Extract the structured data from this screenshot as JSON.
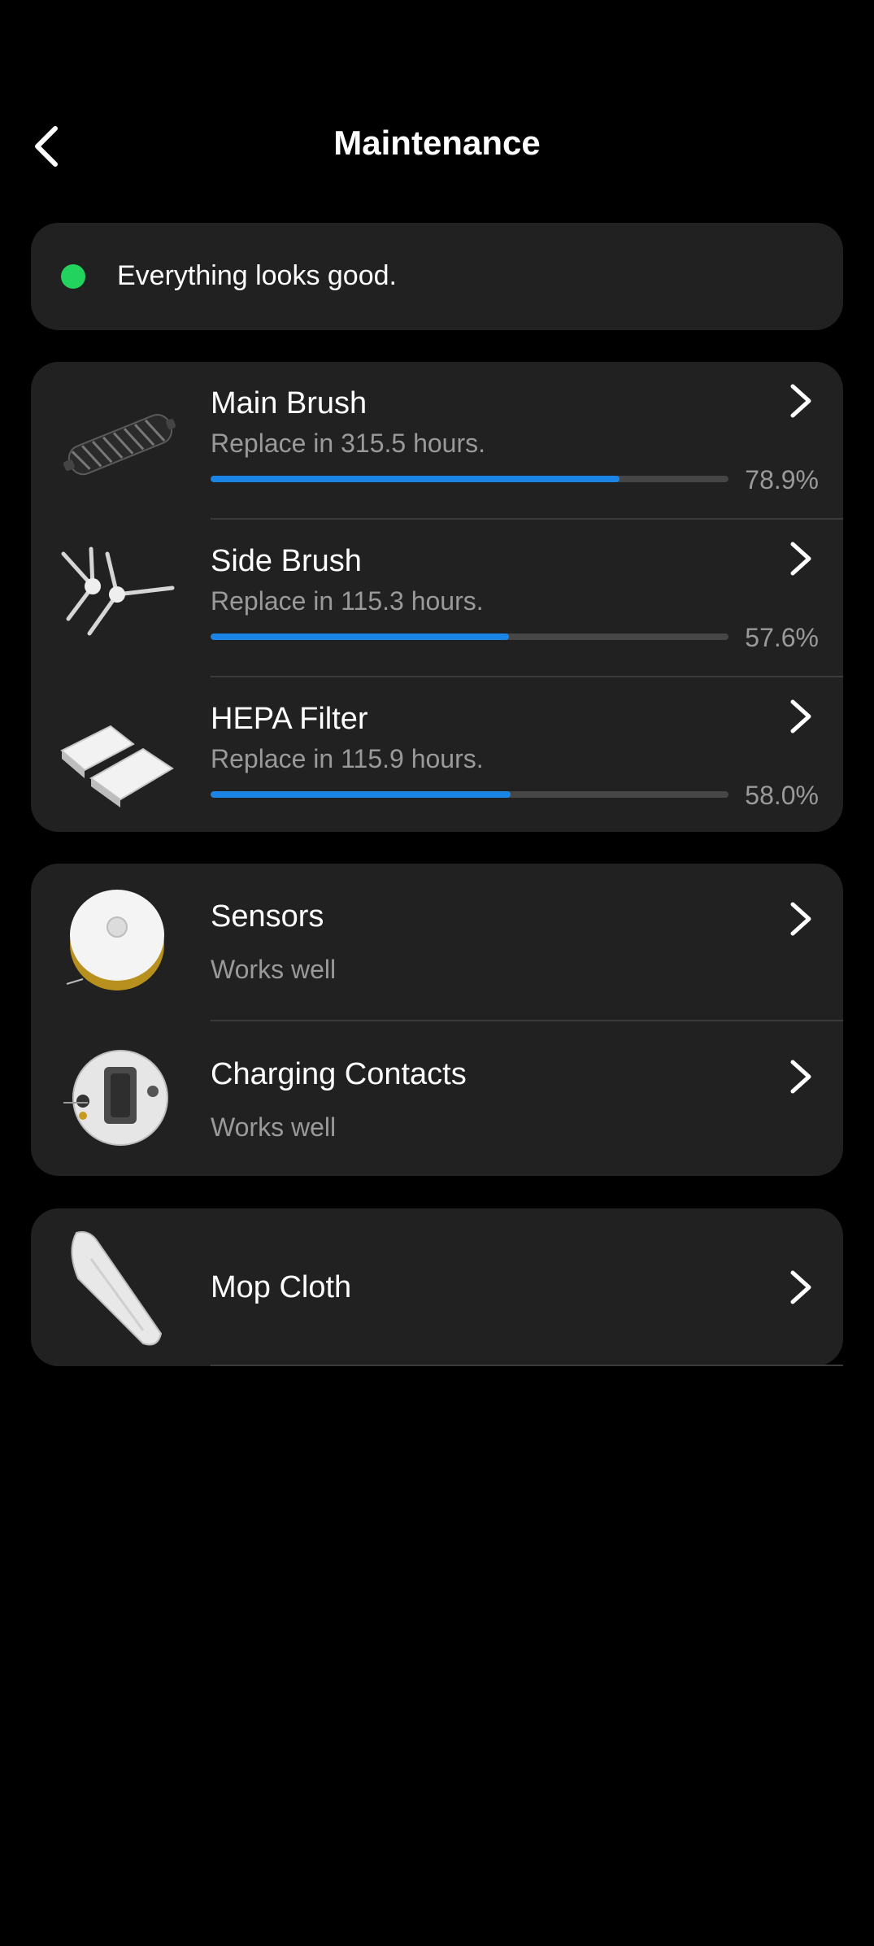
{
  "header": {
    "title": "Maintenance"
  },
  "status": {
    "text": "Everything looks good.",
    "color": "#22d35e"
  },
  "consumables": [
    {
      "name": "Main Brush",
      "subtitle": "Replace in 315.5 hours.",
      "percent": "78.9%",
      "fraction": 0.789,
      "icon": "main-brush-image"
    },
    {
      "name": "Side Brush",
      "subtitle": "Replace in 115.3 hours.",
      "percent": "57.6%",
      "fraction": 0.576,
      "icon": "side-brush-image"
    },
    {
      "name": "HEPA Filter",
      "subtitle": "Replace in 115.9 hours.",
      "percent": "58.0%",
      "fraction": 0.58,
      "icon": "hepa-filter-image"
    }
  ],
  "checks": [
    {
      "name": "Sensors",
      "subtitle": "Works well",
      "icon": "robot-top-image"
    },
    {
      "name": "Charging Contacts",
      "subtitle": "Works well",
      "icon": "robot-bottom-image"
    }
  ],
  "mop": {
    "name": "Mop Cloth",
    "icon": "mop-cloth-image"
  },
  "colors": {
    "accent": "#1a85e6",
    "card": "#212121",
    "background": "#000000"
  }
}
